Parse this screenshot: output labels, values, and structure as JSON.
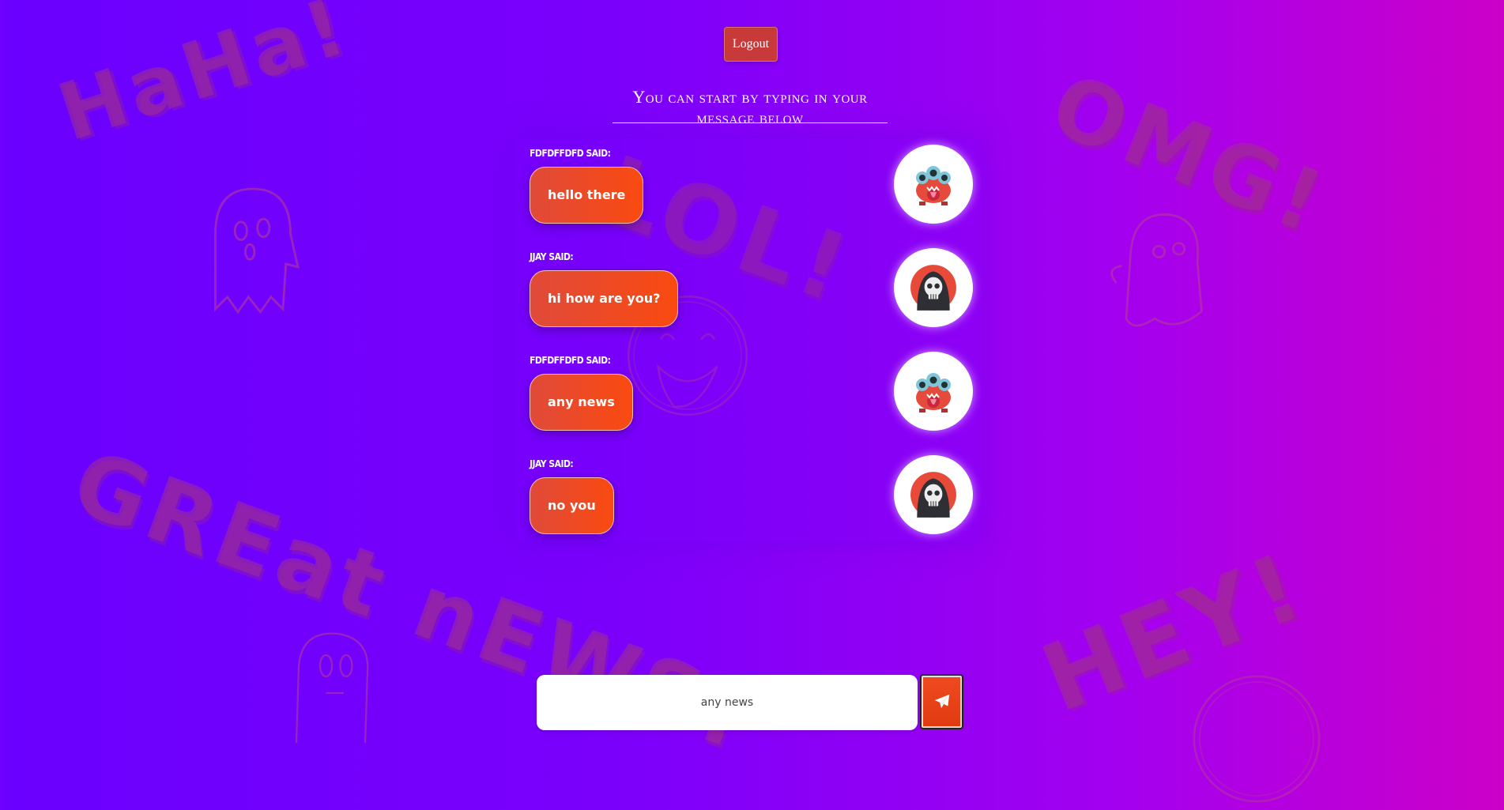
{
  "background": {
    "words": [
      {
        "key": "haha",
        "text": "HaHa!"
      },
      {
        "key": "lol",
        "text": "LOL!"
      },
      {
        "key": "omg",
        "text": "OMG!"
      },
      {
        "key": "great",
        "text": "GREat nEWS!"
      },
      {
        "key": "hey",
        "text": "HEY!"
      }
    ]
  },
  "header": {
    "logout_label": "Logout",
    "heading": "You can start by typing in your message below"
  },
  "messages": [
    {
      "author": "FDFDFFDFD SAID:",
      "text": "hello there",
      "avatar": "three-eyed-monster-icon"
    },
    {
      "author": "JJAY SAID:",
      "text": "hi how are you?",
      "avatar": "grim-reaper-icon"
    },
    {
      "author": "FDFDFFDFD SAID:",
      "text": "any news",
      "avatar": "three-eyed-monster-icon"
    },
    {
      "author": "JJAY SAID:",
      "text": "no you",
      "avatar": "grim-reaper-icon"
    }
  ],
  "composer": {
    "value": "any news",
    "send_icon": "paper-plane-icon"
  },
  "colors": {
    "bubble": "#f04a20",
    "logout": "#c83a3a",
    "background_start": "#6a00ff",
    "background_end": "#cc00c8"
  }
}
